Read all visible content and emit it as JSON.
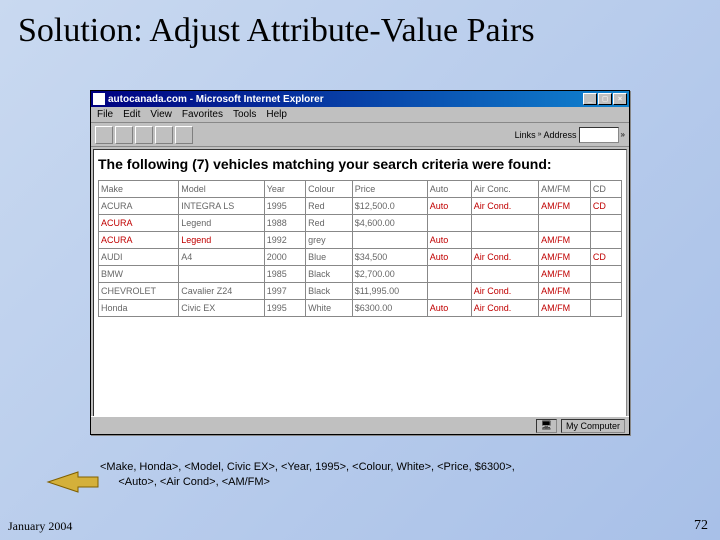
{
  "slide": {
    "title": "Solution: Adjust Attribute-Value Pairs",
    "footer_date": "January 2004",
    "footer_page": "72"
  },
  "browser": {
    "window_title": "autocanada.com - Microsoft Internet Explorer",
    "menus": [
      "File",
      "Edit",
      "View",
      "Favorites",
      "Tools",
      "Help"
    ],
    "links_label": "Links",
    "address_label": "Address",
    "status_text": "My Computer"
  },
  "page": {
    "heading": "The following (7) vehicles matching your search criteria were found:",
    "columns": [
      "Make",
      "Model",
      "Year",
      "Colour",
      "Price",
      "Auto",
      "Air Conc.",
      "AM/FM",
      "CD"
    ],
    "rows": [
      {
        "make": "ACURA",
        "model": "INTEGRA LS",
        "year": "1995",
        "colour": "Red",
        "price": "$12,500.0",
        "auto": "Auto",
        "ac": "Air Cond.",
        "amfm": "AM/FM",
        "cd": "CD",
        "hl": [
          "auto",
          "ac",
          "amfm",
          "cd"
        ]
      },
      {
        "make": "ACURA",
        "model": "Legend",
        "year": "1988",
        "colour": "Red",
        "price": "$4,600.00",
        "auto": "",
        "ac": "",
        "amfm": "",
        "cd": "",
        "hl": [
          "make"
        ]
      },
      {
        "make": "ACURA",
        "model": "Legend",
        "year": "1992",
        "colour": "grey",
        "price": "",
        "auto": "Auto",
        "ac": "",
        "amfm": "AM/FM",
        "cd": "",
        "hl": [
          "make",
          "model",
          "auto",
          "amfm"
        ]
      },
      {
        "make": "AUDI",
        "model": "A4",
        "year": "2000",
        "colour": "Blue",
        "price": "$34,500",
        "auto": "Auto",
        "ac": "Air Cond.",
        "amfm": "AM/FM",
        "cd": "CD",
        "hl": [
          "auto",
          "ac",
          "amfm",
          "cd"
        ]
      },
      {
        "make": "BMW",
        "model": "",
        "year": "1985",
        "colour": "Black",
        "price": "$2,700.00",
        "auto": "",
        "ac": "",
        "amfm": "AM/FM",
        "cd": "",
        "hl": [
          "amfm"
        ]
      },
      {
        "make": "CHEVROLET",
        "model": "Cavalier Z24",
        "year": "1997",
        "colour": "Black",
        "price": "$11,995.00",
        "auto": "",
        "ac": "Air Cond.",
        "amfm": "AM/FM",
        "cd": "",
        "hl": [
          "ac",
          "amfm"
        ]
      },
      {
        "make": "Honda",
        "model": "Civic EX",
        "year": "1995",
        "colour": "White",
        "price": "$6300.00",
        "auto": "Auto",
        "ac": "Air Cond.",
        "amfm": "AM/FM",
        "cd": "",
        "hl": [
          "auto",
          "ac",
          "amfm"
        ]
      }
    ]
  },
  "caption": {
    "line1": "<Make, Honda>, <Model, Civic EX>, <Year, 1995>, <Colour, White>, <Price, $6300>,",
    "line2": "<Auto>, <Air Cond>, <AM/FM>"
  },
  "chart_data": {
    "type": "table",
    "title": "Vehicle search results with highlighted adjusted attribute-value pairs",
    "columns": [
      "Make",
      "Model",
      "Year",
      "Colour",
      "Price",
      "Auto",
      "Air Conc.",
      "AM/FM",
      "CD"
    ],
    "rows": [
      [
        "ACURA",
        "INTEGRA LS",
        "1995",
        "Red",
        "$12,500.0",
        "Auto",
        "Air Cond.",
        "AM/FM",
        "CD"
      ],
      [
        "ACURA",
        "Legend",
        "1988",
        "Red",
        "$4,600.00",
        "",
        "",
        "",
        ""
      ],
      [
        "ACURA",
        "Legend",
        "1992",
        "grey",
        "",
        "Auto",
        "",
        "AM/FM",
        ""
      ],
      [
        "AUDI",
        "A4",
        "2000",
        "Blue",
        "$34,500",
        "Auto",
        "Air Cond.",
        "AM/FM",
        "CD"
      ],
      [
        "BMW",
        "",
        "1985",
        "Black",
        "$2,700.00",
        "",
        "",
        "AM/FM",
        ""
      ],
      [
        "CHEVROLET",
        "Cavalier Z24",
        "1997",
        "Black",
        "$11,995.00",
        "",
        "Air Cond.",
        "AM/FM",
        ""
      ],
      [
        "Honda",
        "Civic EX",
        "1995",
        "White",
        "$6300.00",
        "Auto",
        "Air Cond.",
        "AM/FM",
        ""
      ]
    ]
  }
}
